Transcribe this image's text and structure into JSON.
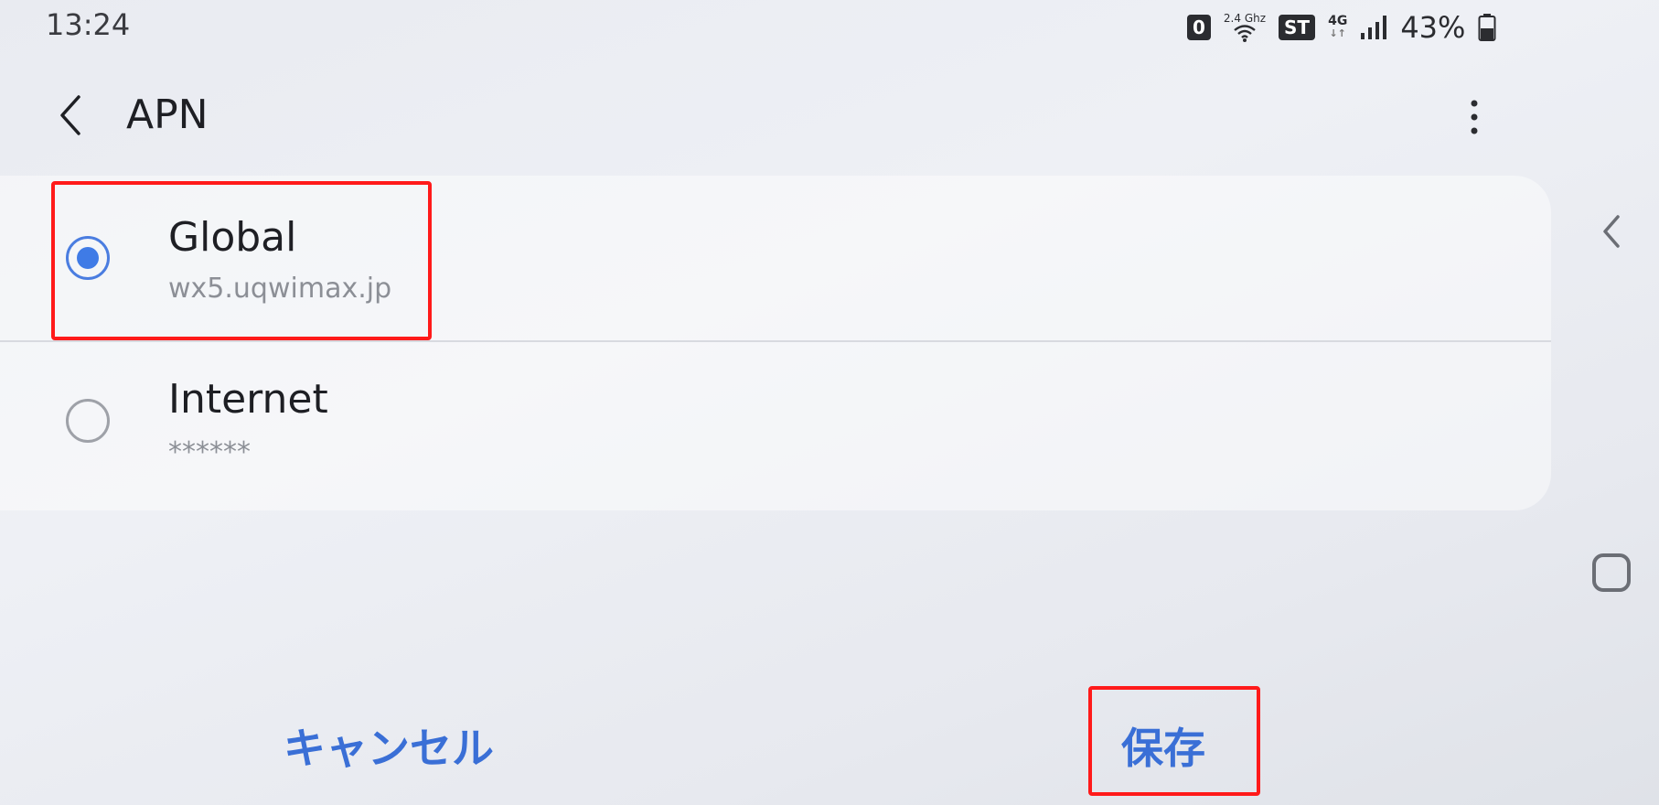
{
  "status_bar": {
    "time": "13:24",
    "badge_zero": "0",
    "wifi_band": "2.4 Ghz",
    "badge_st": "ST",
    "network_type": "4G",
    "network_arrows": "↓↑",
    "battery_percent": "43%"
  },
  "header": {
    "title": "APN"
  },
  "apn_list": [
    {
      "name": "Global",
      "value": "wx5.uqwimax.jp",
      "selected": true
    },
    {
      "name": "Internet",
      "value": "******",
      "selected": false
    }
  ],
  "actions": {
    "cancel_label": "キャンセル",
    "save_label": "保存"
  },
  "colors": {
    "accent": "#3f7be6",
    "button_text": "#3a6fd6",
    "highlight": "#ff1a1a"
  },
  "icons": {
    "back": "chevron-left-icon",
    "more": "more-vertical-icon",
    "nav_back": "nav-back-icon",
    "nav_home": "nav-home-icon"
  }
}
